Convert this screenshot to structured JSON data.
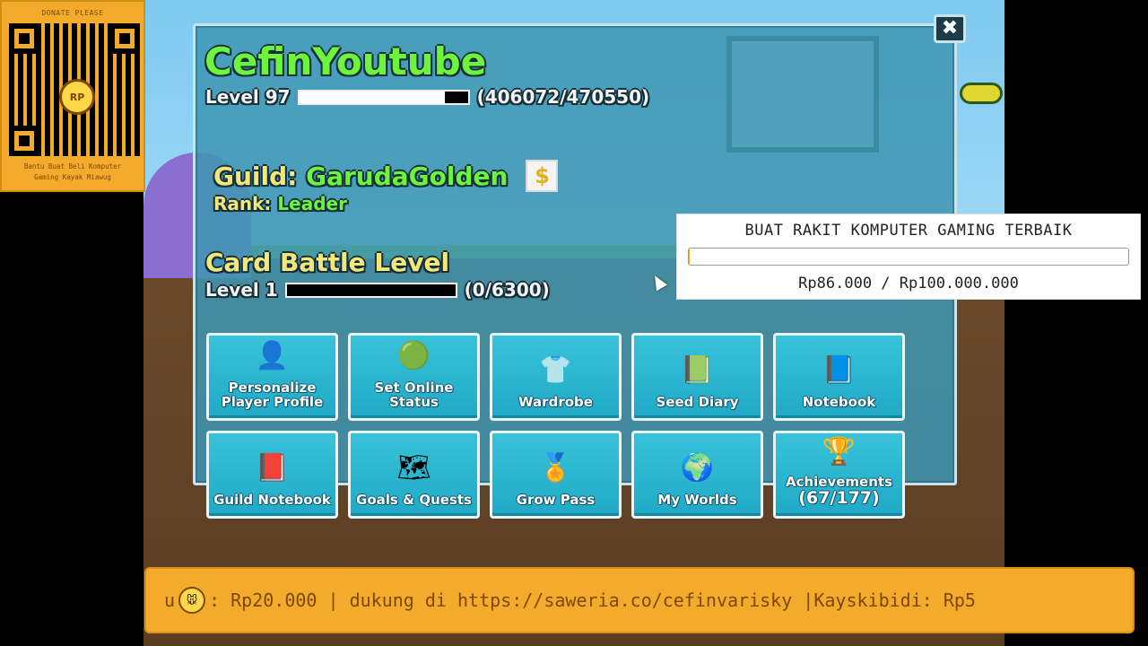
{
  "donate_panel": {
    "header": "DONATE PLEASE",
    "footer_line1": "Bantu Buat Beli Komputer",
    "footer_line2": "Gaming Kayak Miawug",
    "mascot_text": "RP"
  },
  "profile": {
    "player_name": "CefinYoutube",
    "level_label": "Level 97",
    "xp_text": "(406072/470550)",
    "xp_fraction": 0.863,
    "guild_prefix": "Guild: ",
    "guild_name": "GarudaGolden",
    "guild_icon": "$",
    "rank_prefix": "Rank: ",
    "rank_value": "Leader",
    "card_battle_title": "Card Battle Level",
    "card_level_label": "Level 1",
    "card_xp_text": "(0/6300)",
    "card_xp_fraction": 0
  },
  "close_label": "✖",
  "buttons": [
    {
      "label": "Personalize Player Profile",
      "icon": "👤"
    },
    {
      "label": "Set Online Status",
      "icon": "🟢"
    },
    {
      "label": "Wardrobe",
      "icon": "👕"
    },
    {
      "label": "Seed Diary",
      "icon": "📗"
    },
    {
      "label": "Notebook",
      "icon": "📘"
    },
    {
      "label": "Guild Notebook",
      "icon": "📕"
    },
    {
      "label": "Goals & Quests",
      "icon": "🗺"
    },
    {
      "label": "Grow Pass",
      "icon": "🏅"
    },
    {
      "label": "My Worlds",
      "icon": "🌍"
    },
    {
      "label": "Achievements",
      "sub": "(67/177)",
      "icon": "🏆"
    }
  ],
  "donation_target": {
    "title": "BUAT RAKIT KOMPUTER GAMING TERBAIK",
    "amount": "Rp86.000 / Rp100.000.000",
    "progress_fraction": 0.00086
  },
  "ticker": {
    "text_before": "u ",
    "text_after": ": Rp20.000 |  dukung di https://saweria.co/cefinvarisky |Kayskibidi: Rp5"
  },
  "colors": {
    "name_green": "#6cf53c",
    "label_yellow": "#f2e77b",
    "panel_blue": "#3f96b2",
    "button_blue": "#2bb6d1",
    "overlay_orange": "#f4aa2b"
  }
}
